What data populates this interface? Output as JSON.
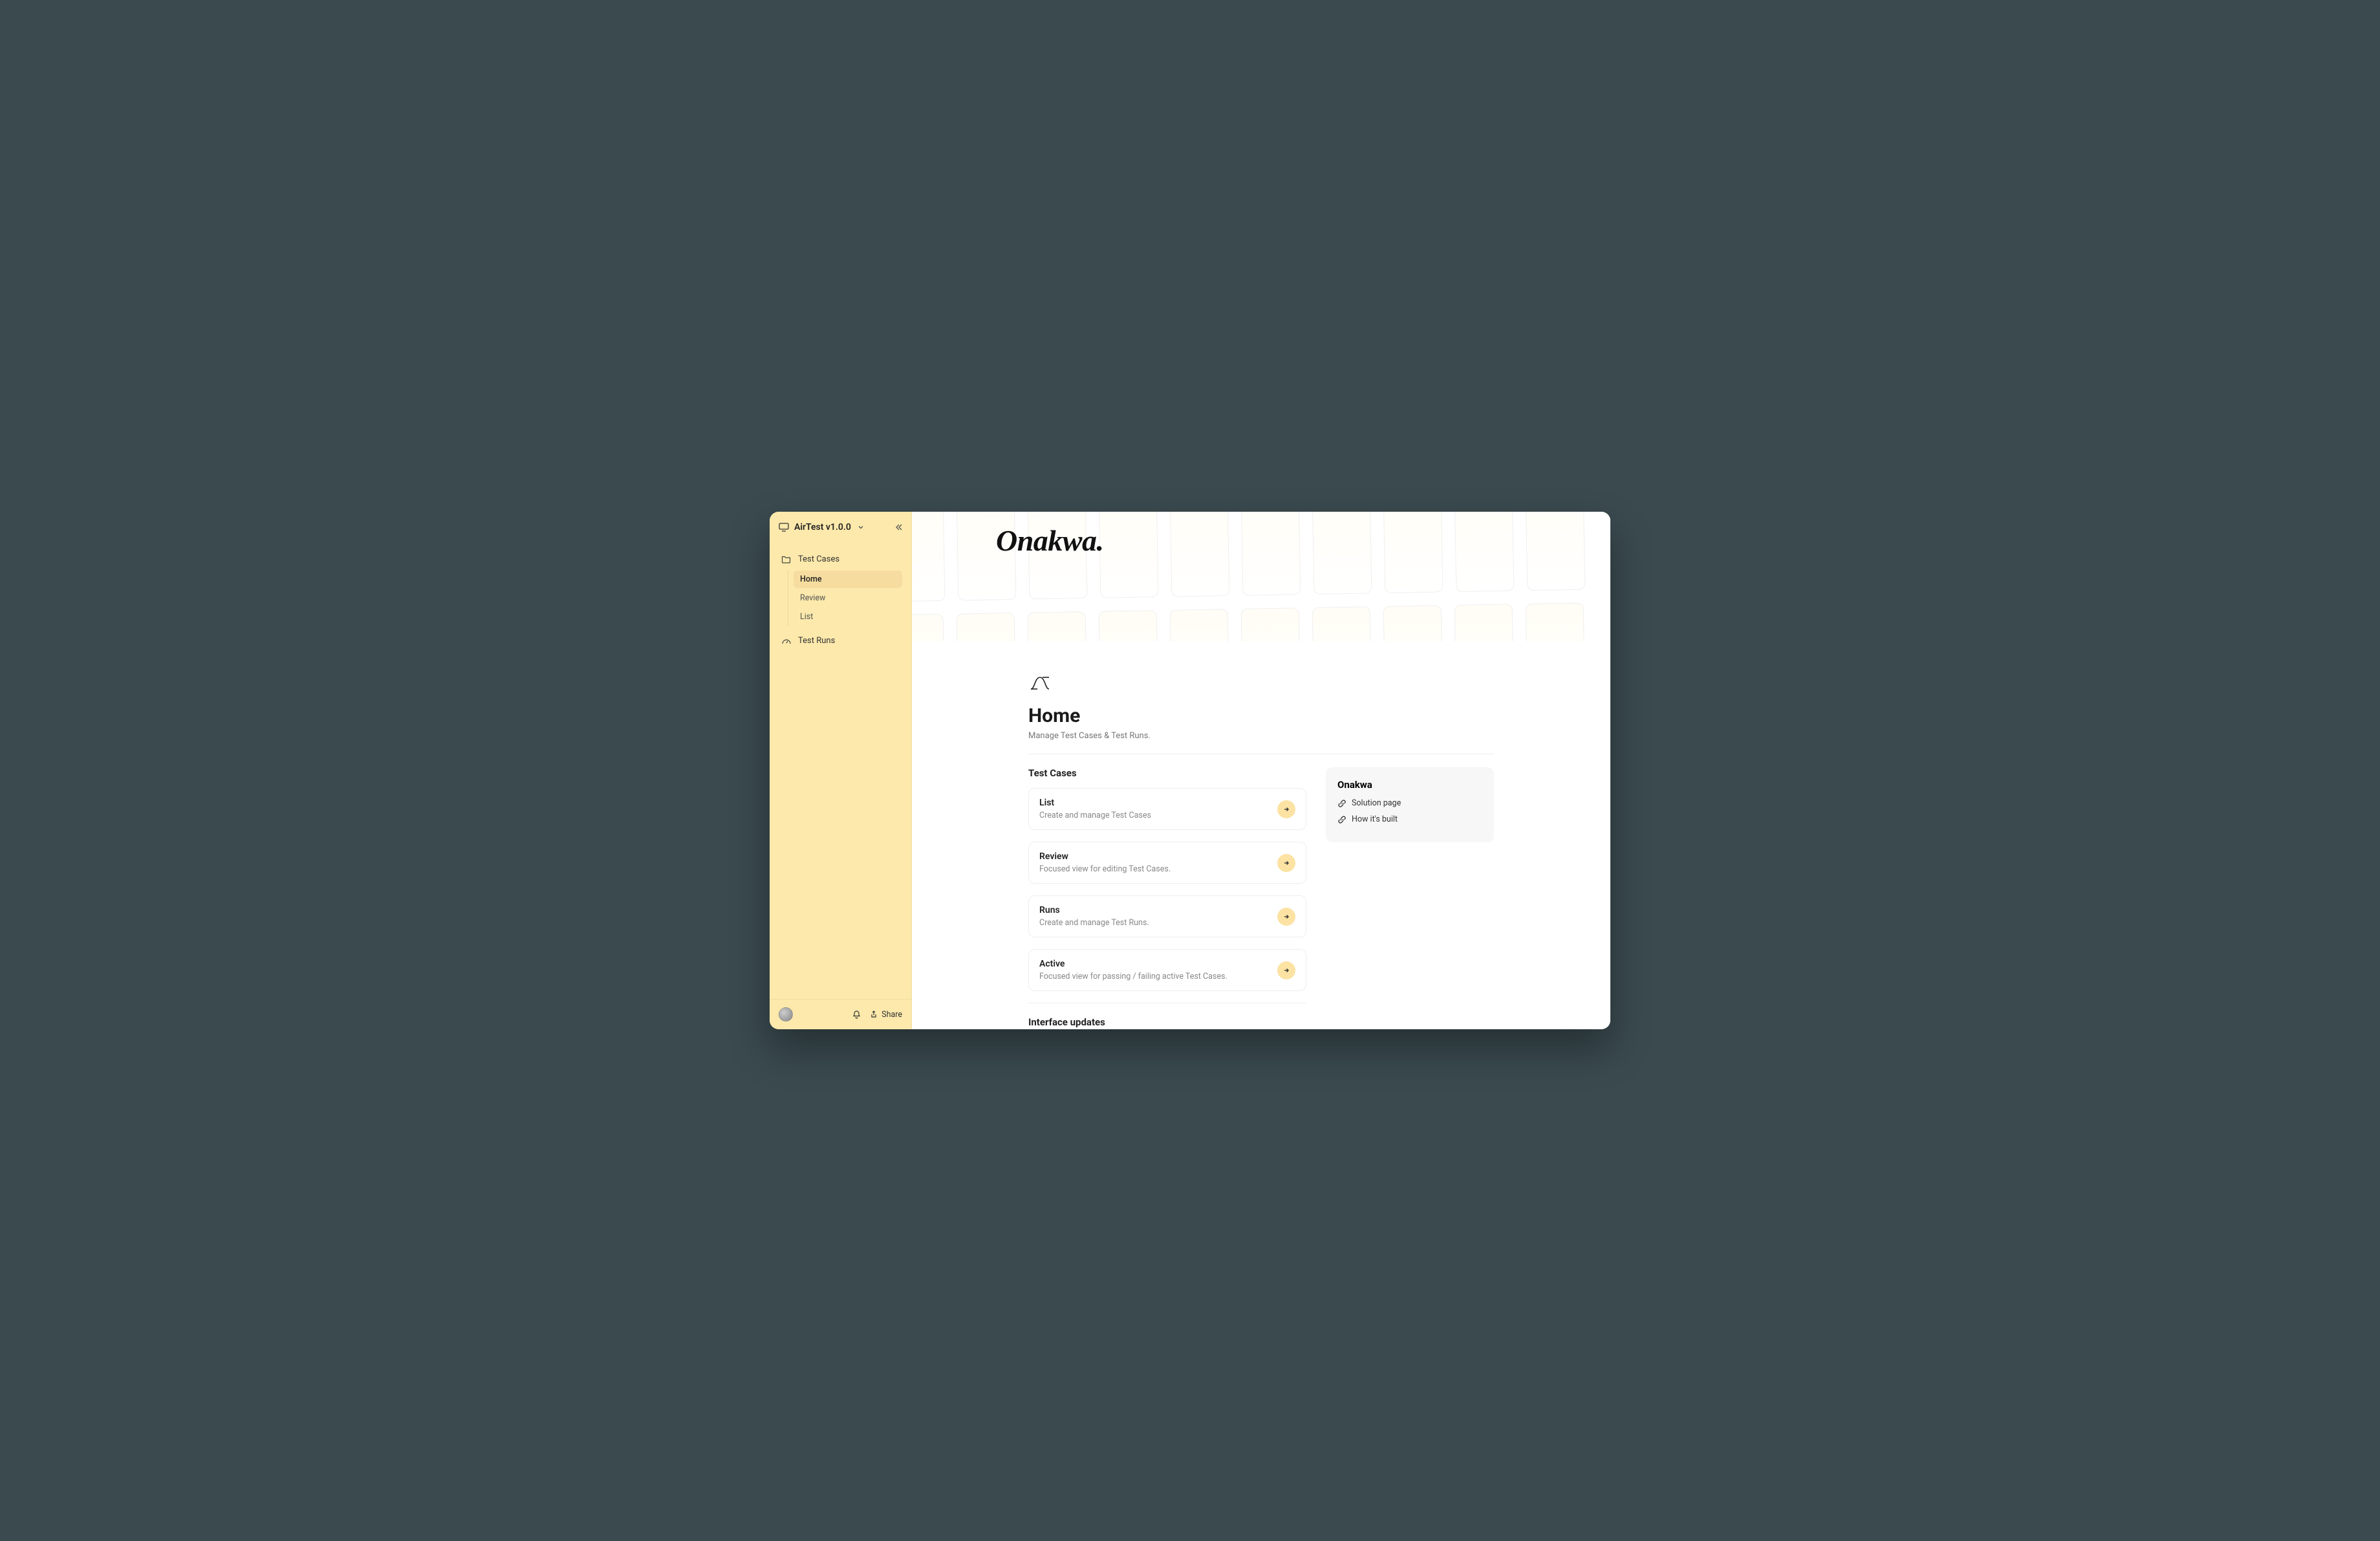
{
  "app": {
    "title": "AirTest v1.0.0"
  },
  "sidebar": {
    "groups": [
      {
        "label": "Test Cases",
        "items": [
          {
            "label": "Home",
            "active": true
          },
          {
            "label": "Review",
            "active": false
          },
          {
            "label": "List",
            "active": false
          }
        ]
      },
      {
        "label": "Test Runs",
        "items": []
      }
    ],
    "share_label": "Share"
  },
  "hero": {
    "logo_text": "Onakwa."
  },
  "page": {
    "title": "Home",
    "subtitle": "Manage Test Cases & Test Runs."
  },
  "sections": {
    "test_cases_heading": "Test Cases",
    "interface_updates_heading": "Interface updates"
  },
  "cards": [
    {
      "title": "List",
      "desc": "Create and manage Test Cases"
    },
    {
      "title": "Review",
      "desc": "Focused view for editing Test Cases."
    },
    {
      "title": "Runs",
      "desc": "Create and manage Test Runs."
    },
    {
      "title": "Active",
      "desc": "Focused view for passing / failing active Test Cases."
    }
  ],
  "sidecard": {
    "title": "Onakwa",
    "links": [
      {
        "label": "Solution page"
      },
      {
        "label": "How it's built"
      }
    ]
  }
}
